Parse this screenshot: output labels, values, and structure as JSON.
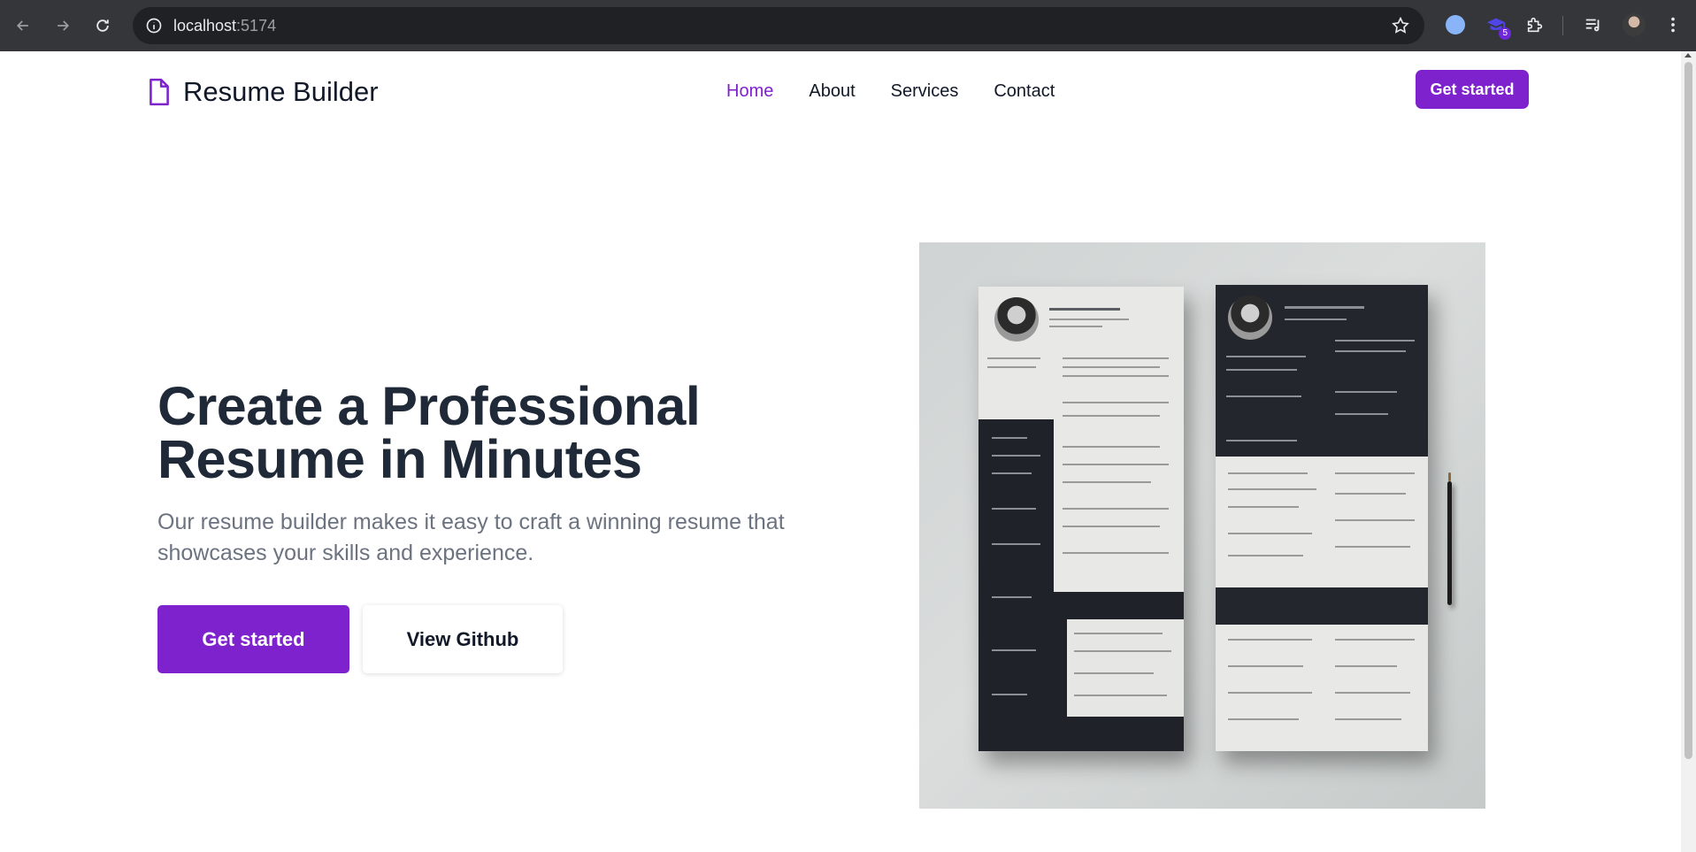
{
  "browser": {
    "url_host": "localhost",
    "url_port": ":5174",
    "extension_badge": "5"
  },
  "navbar": {
    "brand": "Resume Builder",
    "menu": [
      {
        "label": "Home",
        "active": true
      },
      {
        "label": "About",
        "active": false
      },
      {
        "label": "Services",
        "active": false
      },
      {
        "label": "Contact",
        "active": false
      }
    ],
    "cta": "Get started"
  },
  "hero": {
    "title_line1": "Create a Professional",
    "title_line2": "Resume in Minutes",
    "subtitle": "Our resume builder makes it easy to craft a winning resume that showcases your skills and experience.",
    "primary_button": "Get started",
    "secondary_button": "View Github"
  },
  "colors": {
    "accent": "#7e22ce",
    "heading": "#1f2937",
    "muted": "#6b7280"
  }
}
